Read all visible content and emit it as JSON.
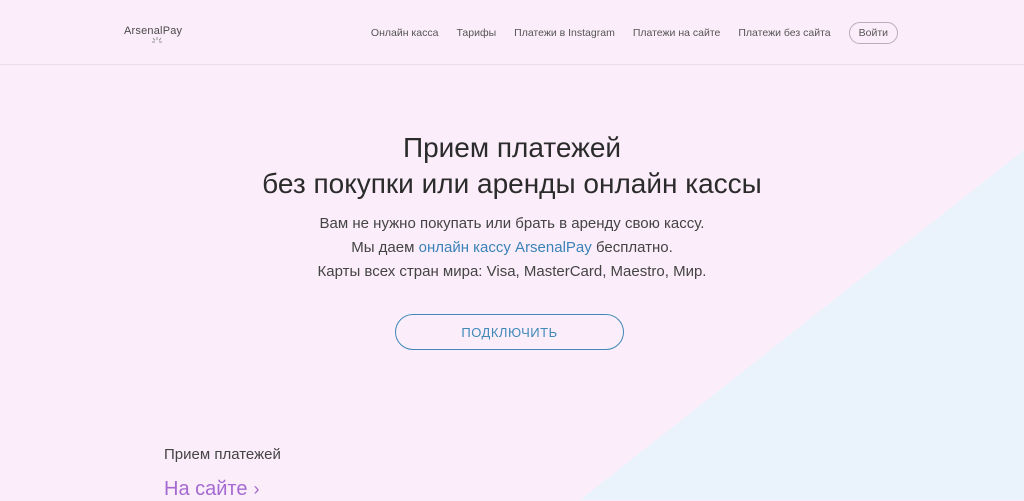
{
  "header": {
    "logo_text": "ArsenalPay",
    "nav": [
      "Онлайн касса",
      "Тарифы",
      "Платежи в Instagram",
      "Платежи на сайте",
      "Платежи без сайта"
    ],
    "login_label": "Войти"
  },
  "hero": {
    "title_line1": "Прием платежей",
    "title_line2": "без покупки или аренды онлайн кассы",
    "sub_line1": "Вам не нужно покупать или брать в аренду свою кассу.",
    "sub_line2_prefix": "Мы даем ",
    "sub_line2_link": "онлайн кассу ArsenalPay",
    "sub_line2_suffix": " бесплатно.",
    "sub_line3": "Карты всех стран мира: Visa, MasterCard, Maestro, Мир.",
    "cta_label": "ПОДКЛЮЧИТЬ"
  },
  "section": {
    "label": "Прием платежей",
    "link": "На сайте",
    "chevron": "›"
  },
  "colors": {
    "background": "#fbeefa",
    "accent_blue": "#3f88b8",
    "accent_purple": "#a56ad1",
    "shape_blue": "#eaf3fb"
  }
}
